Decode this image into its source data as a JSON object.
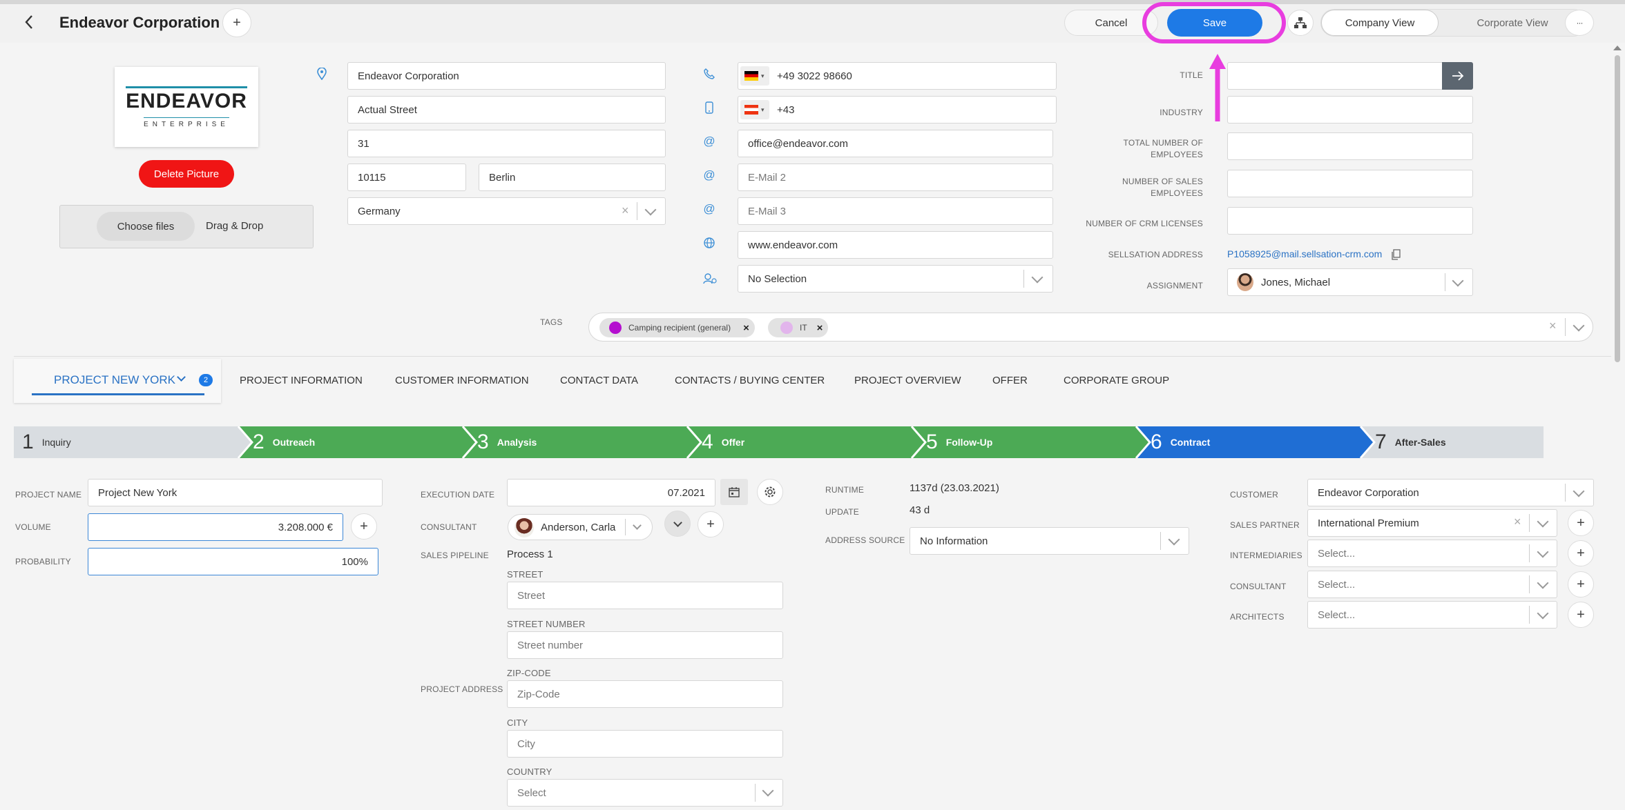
{
  "header": {
    "title": "Endeavor Corporation",
    "cancel": "Cancel",
    "save": "Save",
    "company_view": "Company View",
    "corporate_view": "Corporate View",
    "more": "···"
  },
  "picture": {
    "logo_main": "ENDEAVOR",
    "logo_sub": "ENTERPRISE",
    "delete": "Delete Picture",
    "choose_files": "Choose files",
    "drag_drop": "Drag & Drop"
  },
  "address": {
    "name": "Endeavor Corporation",
    "street": "Actual Street",
    "number": "31",
    "zip": "10115",
    "city": "Berlin",
    "country": "Germany"
  },
  "contact": {
    "phone": "+49 3022 98660",
    "mobile": "+43",
    "email1": "office@endeavor.com",
    "email2_ph": "E-Mail 2",
    "email3_ph": "E-Mail 3",
    "website": "www.endeavor.com",
    "selection": "No Selection"
  },
  "company_fields": {
    "title_label": "TITLE",
    "industry_label": "INDUSTRY",
    "employees_label": "TOTAL NUMBER OF EMPLOYEES",
    "sales_employees_label": "NUMBER OF SALES EMPLOYEES",
    "crm_licenses_label": "NUMBER OF CRM LICENSES",
    "sellsation_label": "SELLSATION ADDRESS",
    "sellsation_value": "P1058925@mail.sellsation-crm.com",
    "assignment_label": "ASSIGNMENT",
    "assignment_value": "Jones, Michael"
  },
  "tags": {
    "label": "TAGS",
    "items": [
      {
        "label": "Camping recipient (general)",
        "color": "#b40fcf"
      },
      {
        "label": "IT",
        "color": "#e2b5ec"
      }
    ]
  },
  "tabs": {
    "active": "PROJECT NEW YORK",
    "badge": "2",
    "items": [
      "PROJECT INFORMATION",
      "CUSTOMER INFORMATION",
      "CONTACT DATA",
      "CONTACTS / BUYING CENTER",
      "PROJECT OVERVIEW",
      "OFFER",
      "CORPORATE GROUP"
    ]
  },
  "pipeline": [
    {
      "n": "1",
      "label": "Inquiry"
    },
    {
      "n": "2",
      "label": "Outreach"
    },
    {
      "n": "3",
      "label": "Analysis"
    },
    {
      "n": "4",
      "label": "Offer"
    },
    {
      "n": "5",
      "label": "Follow-Up"
    },
    {
      "n": "6",
      "label": "Contract"
    },
    {
      "n": "7",
      "label": "After-Sales"
    }
  ],
  "project": {
    "name_label": "PROJECT NAME",
    "name": "Project New York",
    "volume_label": "VOLUME",
    "volume": "3.208.000 €",
    "probability_label": "PROBABILITY",
    "probability": "100%",
    "exec_label": "EXECUTION DATE",
    "exec_date": "07.2021",
    "consultant_label": "CONSULTANT",
    "consultant": "Anderson, Carla",
    "pipeline_label": "SALES PIPELINE",
    "pipeline": "Process 1",
    "address_label": "PROJECT ADDRESS",
    "street_label": "STREET",
    "street_ph": "Street",
    "number_label": "STREET NUMBER",
    "number_ph": "Street number",
    "zip_label": "ZIP-CODE",
    "zip_ph": "Zip-Code",
    "city_label": "CITY",
    "city_ph": "City",
    "country_label": "COUNTRY",
    "country_ph": "Select",
    "runtime_label": "RUNTIME",
    "runtime": "1137d (23.03.2021)",
    "update_label": "UPDATE",
    "update": "43 d",
    "source_label": "ADDRESS SOURCE",
    "source": "No Information",
    "customer_label": "CUSTOMER",
    "customer": "Endeavor Corporation",
    "partner_label": "SALES PARTNER",
    "partner": "International Premium",
    "intermediaries_label": "INTERMEDIARIES",
    "consultant2_label": "CONSULTANT",
    "architects_label": "ARCHITECTS",
    "select_ph": "Select..."
  }
}
